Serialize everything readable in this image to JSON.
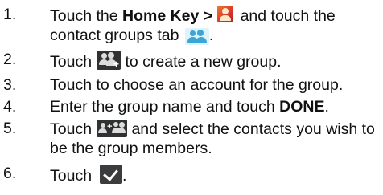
{
  "steps": [
    {
      "number": "1.",
      "before_bold": "Touch the ",
      "bold": "Home Key >",
      "after_icon": " and touch the",
      "line2": "contact groups tab",
      "line2_after": ".",
      "icons": [
        "contacts-app-icon",
        "contact-groups-tab-icon"
      ]
    },
    {
      "number": "2.",
      "before_icon": "Touch",
      "after_icon": " to create a new group.",
      "icons": [
        "new-group-icon"
      ]
    },
    {
      "number": "3.",
      "text": "Touch to choose an account for the group."
    },
    {
      "number": "4.",
      "before_bold": "Enter the group name and touch ",
      "bold": "DONE",
      "after_bold": "."
    },
    {
      "number": "5.",
      "before_icon": "Touch",
      "after_icon": " and select the contacts you wish to",
      "line2": "be the group members.",
      "icons": [
        "add-members-icon"
      ]
    },
    {
      "number": "6.",
      "before_icon": "Touch",
      "after_icon": ".",
      "icons": [
        "checkmark-icon"
      ]
    }
  ]
}
